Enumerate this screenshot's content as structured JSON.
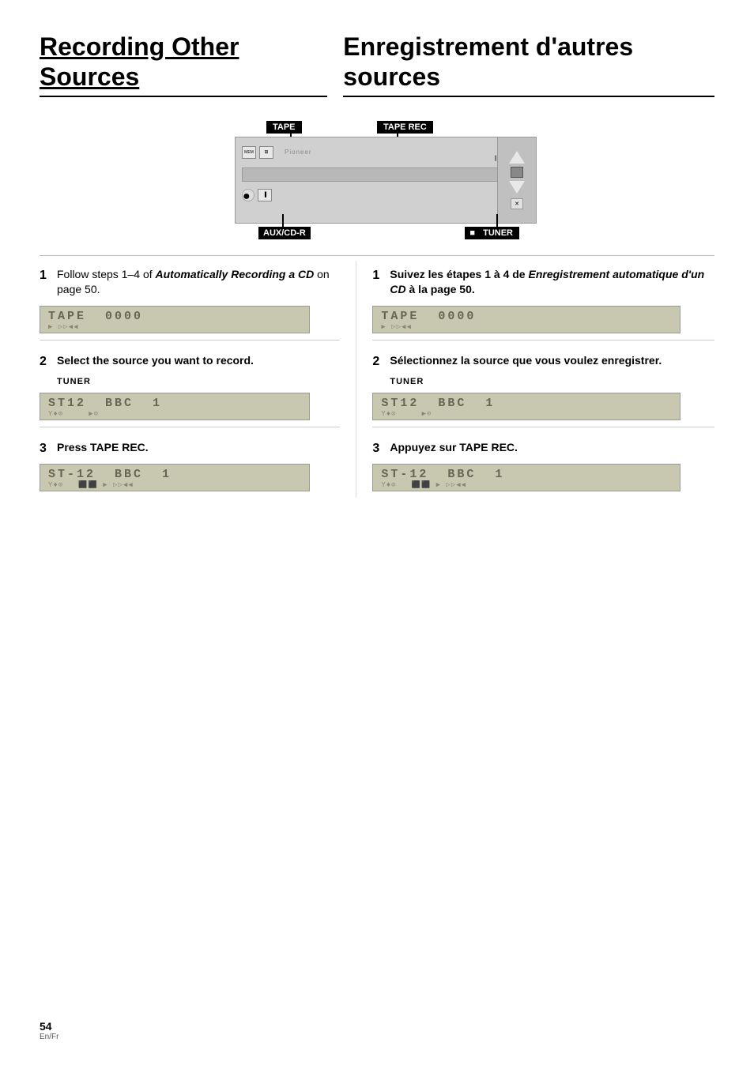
{
  "header": {
    "title_en": "Recording Other Sources",
    "title_fr": "Enregistrement d'autres sources"
  },
  "diagram": {
    "label_tape": "TAPE",
    "label_taperec": "TAPE REC",
    "label_auxcdr": "AUX/CD-R",
    "label_tuner": "TUNER"
  },
  "steps_en": [
    {
      "num": "1",
      "text": "Follow steps 1–4 of Automatically Recording a CD on page 50."
    },
    {
      "num": "2",
      "text": "Select the source you want to record.",
      "sublabel": "TUNER"
    },
    {
      "num": "3",
      "text": "Press TAPE REC."
    }
  ],
  "steps_fr": [
    {
      "num": "1",
      "text": "Suivez les étapes 1 à 4 de Enregistrement automatique d'un CD à la page 50."
    },
    {
      "num": "2",
      "text": "Sélectionnez la source que vous voulez enregistrer.",
      "sublabel": "TUNER"
    },
    {
      "num": "3",
      "text": "Appuyez sur TAPE REC."
    }
  ],
  "lcd": {
    "tape_display_main": "TAPE  0000",
    "tape_display_sub": "▶ ▷▷◀◀",
    "tuner_display_main": "ST12  BBC  1",
    "tuner_display_sub": "Υ♦⊙        ▶⊙",
    "tuner_rec_main": "ST-12  BBC  1",
    "tuner_rec_sub": "Υ♦⊙   ⬛⬛  ▶ ▷▷◀◀"
  },
  "footer": {
    "page_num": "54",
    "page_lang": "En/Fr"
  }
}
